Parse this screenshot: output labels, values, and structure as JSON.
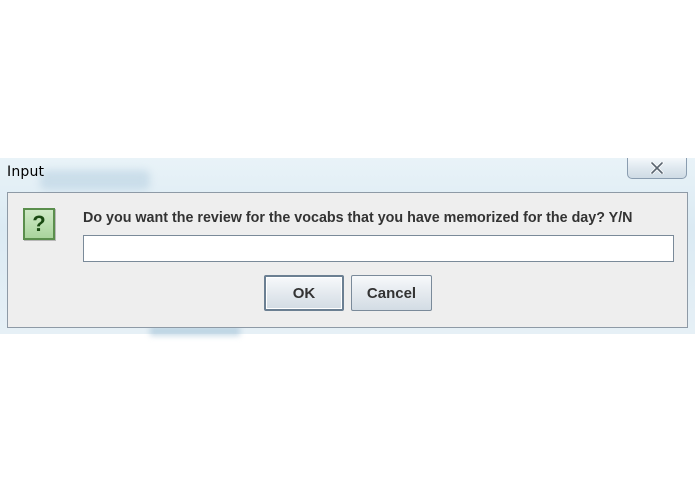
{
  "window": {
    "title": "Input",
    "close_icon": "close-x-icon"
  },
  "dialog": {
    "icon": "question-icon",
    "icon_glyph": "?",
    "icon_color": "#1a4a12",
    "message": "Do you want the review for the vocabs that you have memorized for the day? Y/N",
    "input_value": "",
    "ok_label": "OK",
    "cancel_label": "Cancel"
  }
}
